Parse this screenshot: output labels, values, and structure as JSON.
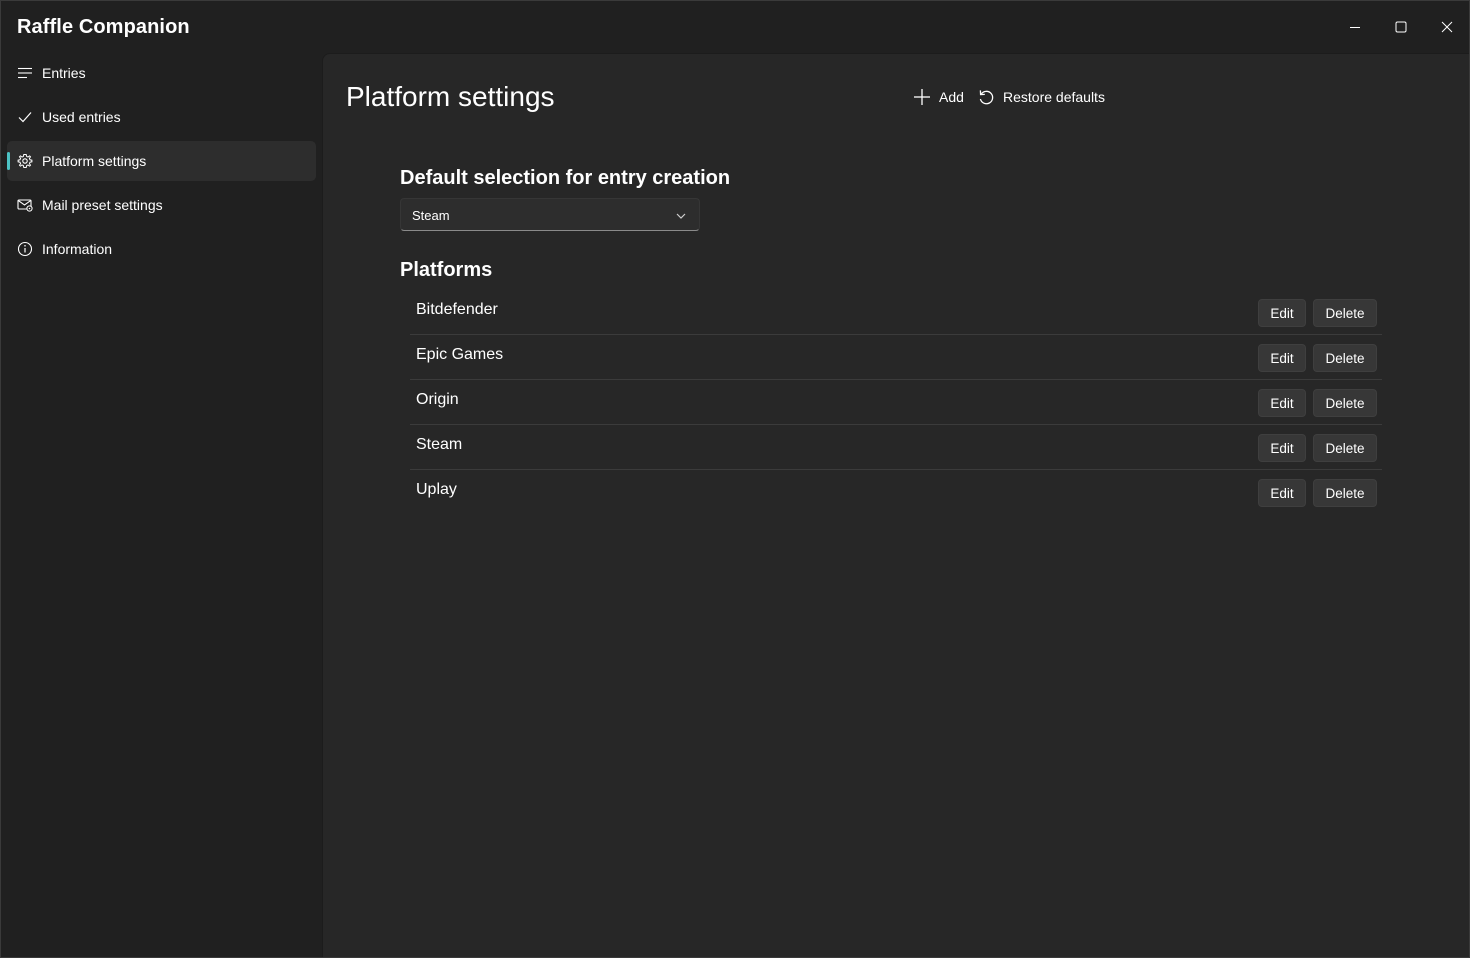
{
  "window": {
    "title": "Raffle Companion",
    "minimize_icon": "minimize-icon",
    "maximize_icon": "maximize-icon",
    "close_icon": "close-icon"
  },
  "sidebar": {
    "items": [
      {
        "label": "Entries",
        "icon": "list-icon",
        "selected": false
      },
      {
        "label": "Used entries",
        "icon": "checkmark-icon",
        "selected": false
      },
      {
        "label": "Platform settings",
        "icon": "gear-icon",
        "selected": true
      },
      {
        "label": "Mail preset settings",
        "icon": "mail-settings-icon",
        "selected": false
      },
      {
        "label": "Information",
        "icon": "info-icon",
        "selected": false
      }
    ],
    "accent_color": "#4cc2c4"
  },
  "main": {
    "title": "Platform settings",
    "commands": {
      "add_label": "Add",
      "add_icon": "plus-icon",
      "restore_label": "Restore defaults",
      "restore_icon": "undo-icon"
    },
    "default_selection": {
      "heading": "Default selection for entry creation",
      "value": "Steam",
      "chevron_icon": "chevron-down-icon"
    },
    "platforms": {
      "heading": "Platforms",
      "edit_label": "Edit",
      "delete_label": "Delete",
      "items": [
        {
          "name": "Bitdefender"
        },
        {
          "name": "Epic Games"
        },
        {
          "name": "Origin"
        },
        {
          "name": "Steam"
        },
        {
          "name": "Uplay"
        }
      ]
    }
  }
}
